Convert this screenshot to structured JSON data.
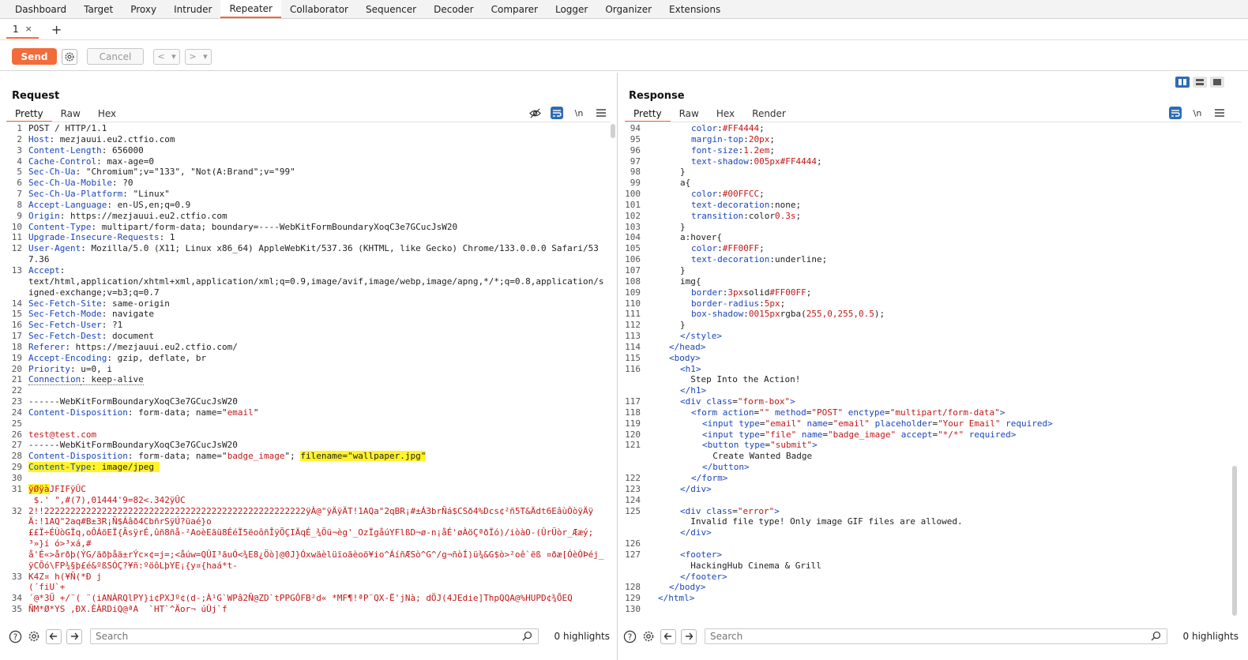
{
  "nav": {
    "tabs": [
      "Dashboard",
      "Target",
      "Proxy",
      "Intruder",
      "Repeater",
      "Collaborator",
      "Sequencer",
      "Decoder",
      "Comparer",
      "Logger",
      "Organizer",
      "Extensions"
    ],
    "active": "Repeater"
  },
  "subtabs": {
    "tab1_label": "1",
    "close": "×",
    "add": "+"
  },
  "toolbar": {
    "send": "Send",
    "cancel": "Cancel",
    "prev": "<",
    "next": ">",
    "drop": "▾"
  },
  "request": {
    "title": "Request",
    "tabs": [
      "Pretty",
      "Raw",
      "Hex"
    ],
    "icons": [
      "eye-off-icon",
      "wrap-icon",
      "newline-icon",
      "menu-icon"
    ],
    "lines": [
      {
        "n": "1",
        "parts": [
          [
            "",
            "POST / HTTP/1.1"
          ]
        ]
      },
      {
        "n": "2",
        "parts": [
          [
            "hk",
            "Host"
          ],
          [
            "",
            ": mezjauui.eu2.ctfio.com"
          ]
        ]
      },
      {
        "n": "3",
        "parts": [
          [
            "hk",
            "Content-Length"
          ],
          [
            "",
            ": 656000"
          ]
        ]
      },
      {
        "n": "4",
        "parts": [
          [
            "hk",
            "Cache-Control"
          ],
          [
            "",
            ": max-age=0"
          ]
        ]
      },
      {
        "n": "5",
        "parts": [
          [
            "hk",
            "Sec-Ch-Ua"
          ],
          [
            "",
            ": \"Chromium\";v=\"133\", \"Not(A:Brand\";v=\"99\""
          ]
        ]
      },
      {
        "n": "6",
        "parts": [
          [
            "hk",
            "Sec-Ch-Ua-Mobile"
          ],
          [
            "",
            ": ?0"
          ]
        ]
      },
      {
        "n": "7",
        "parts": [
          [
            "hk",
            "Sec-Ch-Ua-Platform"
          ],
          [
            "",
            ": \"Linux\""
          ]
        ]
      },
      {
        "n": "8",
        "parts": [
          [
            "hk",
            "Accept-Language"
          ],
          [
            "",
            ": en-US,en;q=0.9"
          ]
        ]
      },
      {
        "n": "9",
        "parts": [
          [
            "hk",
            "Origin"
          ],
          [
            "",
            ": https://mezjauui.eu2.ctfio.com"
          ]
        ]
      },
      {
        "n": "10",
        "parts": [
          [
            "hk",
            "Content-Type"
          ],
          [
            "",
            ": multipart/form-data; boundary=----WebKitFormBoundaryXoqC3e7GCucJsW20"
          ]
        ]
      },
      {
        "n": "11",
        "parts": [
          [
            "hk",
            "Upgrade-Insecure-Requests"
          ],
          [
            "",
            ": 1"
          ]
        ]
      },
      {
        "n": "12",
        "parts": [
          [
            "hk",
            "User-Agent"
          ],
          [
            "",
            ": Mozilla/5.0 (X11; Linux x86_64) AppleWebKit/537.36 (KHTML, like Gecko) Chrome/133.0.0.0 Safari/537.36"
          ]
        ]
      },
      {
        "n": "13",
        "parts": [
          [
            "hk",
            "Accept"
          ],
          [
            "",
            ":\ntext/html,application/xhtml+xml,application/xml;q=0.9,image/avif,image/webp,image/apng,*/*;q=0.8,application/signed-exchange;v=b3;q=0.7"
          ]
        ]
      },
      {
        "n": "14",
        "parts": [
          [
            "hk",
            "Sec-Fetch-Site"
          ],
          [
            "",
            ": same-origin"
          ]
        ]
      },
      {
        "n": "15",
        "parts": [
          [
            "hk",
            "Sec-Fetch-Mode"
          ],
          [
            "",
            ": navigate"
          ]
        ]
      },
      {
        "n": "16",
        "parts": [
          [
            "hk",
            "Sec-Fetch-User"
          ],
          [
            "",
            ": ?1"
          ]
        ]
      },
      {
        "n": "17",
        "parts": [
          [
            "hk",
            "Sec-Fetch-Dest"
          ],
          [
            "",
            ": document"
          ]
        ]
      },
      {
        "n": "18",
        "parts": [
          [
            "hk",
            "Referer"
          ],
          [
            "",
            ": https://mezjauui.eu2.ctfio.com/"
          ]
        ]
      },
      {
        "n": "19",
        "parts": [
          [
            "hk",
            "Accept-Encoding"
          ],
          [
            "",
            ": gzip, deflate, br"
          ]
        ]
      },
      {
        "n": "20",
        "parts": [
          [
            "hk",
            "Priority"
          ],
          [
            "",
            ": u=0, i"
          ]
        ]
      },
      {
        "n": "21",
        "parts": [
          [
            "hk dots",
            "Connection"
          ],
          [
            "dots",
            ": keep-alive"
          ]
        ]
      },
      {
        "n": "22",
        "parts": [
          [
            "",
            ""
          ]
        ]
      },
      {
        "n": "23",
        "parts": [
          [
            "",
            "------WebKitFormBoundaryXoqC3e7GCucJsW20"
          ]
        ]
      },
      {
        "n": "24",
        "parts": [
          [
            "hk",
            "Content-Disposition"
          ],
          [
            "",
            ": form-data; name=\""
          ],
          [
            "red",
            "email"
          ],
          [
            "",
            "\""
          ]
        ]
      },
      {
        "n": "25",
        "parts": [
          [
            "",
            ""
          ]
        ]
      },
      {
        "n": "26",
        "parts": [
          [
            "red",
            "test@test.com"
          ]
        ]
      },
      {
        "n": "27",
        "parts": [
          [
            "",
            "------WebKitFormBoundaryXoqC3e7GCucJsW20"
          ]
        ]
      },
      {
        "n": "28",
        "parts": [
          [
            "hk",
            "Content-Disposition"
          ],
          [
            "",
            ": form-data; name=\""
          ],
          [
            "red",
            "badge_image"
          ],
          [
            "",
            "\"; "
          ],
          [
            "hl",
            "filename=\"wallpaper.jpg\""
          ]
        ]
      },
      {
        "n": "29",
        "parts": [
          [
            "hl hk",
            "Content-Type"
          ],
          [
            "hl",
            ": image/jpeg "
          ]
        ]
      },
      {
        "n": "30",
        "parts": [
          [
            "",
            ""
          ]
        ]
      },
      {
        "n": "31",
        "parts": [
          [
            "red hl",
            "ÿØÿà"
          ],
          [
            "red",
            "JFIFÿÛC\n $.' \",#(7),01444'9=82<.342ÿÛC"
          ]
        ]
      },
      {
        "n": "32",
        "parts": [
          [
            "red",
            "2!!22222222222222222222222222222222222222222222222222ÿÀ@\"ÿÄÿÄT!1AQa\"2qBR¡#±Á3brÑá$CSð4%Dcs¢²ñ5T&Ädt6EâùÒòÿÄÿÄ:!1AQ\"2aq#B±3R¡Ñ$Áâð4CbñrSÿÚ?üaé}o\n££Ï÷ÉÙòGÏq,oÔÁöEÏ{ÃsÿrÉ,ûñ8ñå-²AoèEãü8ÉéÏ5ëoôñÎÿÕÇIÄqÉ_¾Öü¬èg'_OzÏgåúYFlßD¬ø-n¡åÉ'øÀöÇªðÏó)/iòàO-(ÛrÜòr_Ææý;³»}í ó>³xá,#\nå'É«>årðþ(ÝG/äðþåä±rÝc×¢=j=;<åúw=QÛI³ãuÓ<¾E8¿Öò]@0J}Óxwäèlüïoãèoö¥io^ÁíñÆSò^G^/g¬ñòÍ)ü¾&G$ò>²oê`ëß ¤ðæ[ÓèÒÞéj_ÿCÕó\\FP¾§þ£é&ºßSÓÇ?¥ñ:ºöôLþYE¡{y¤{haá*t-"
          ]
        ]
      },
      {
        "n": "33",
        "parts": [
          [
            "red",
            "K4Z¤ h(¥Ñ(*Ð j\n(´fiU`+"
          ]
        ]
      },
      {
        "n": "34",
        "parts": [
          [
            "red",
            "´@*3Ü +/¨( ¨(iANÀRQlPY}i¢PXJº¢(d-;À¹G`WPâ2Ñ@ZD`tPPGÔFB²d« *MF¶!ªP¨QX-Ë'jNà; dÖJ(4JEdie]ThpQQA@%HUPD¢¾ÕEQ"
          ]
        ]
      },
      {
        "n": "35",
        "parts": [
          [
            "red",
            "ÑM*Ø*YS ,ÐX.ÈÀRDiQ@ªA  `HT`^Äor¬ úÙj`f"
          ]
        ]
      }
    ]
  },
  "response": {
    "title": "Response",
    "tabs": [
      "Pretty",
      "Raw",
      "Hex",
      "Render"
    ],
    "icons": [
      "wrap-icon",
      "newline-icon",
      "menu-icon"
    ],
    "lines": [
      {
        "n": "94",
        "ind": 4,
        "parts": [
          [
            "cssp",
            "color"
          ],
          [
            "",
            ":"
          ],
          [
            "cssv",
            "#FF4444"
          ],
          [
            "",
            ";"
          ]
        ]
      },
      {
        "n": "95",
        "ind": 4,
        "parts": [
          [
            "cssp",
            "margin-top"
          ],
          [
            "",
            ":"
          ],
          [
            "cssv",
            "20px"
          ],
          [
            "",
            ";"
          ]
        ]
      },
      {
        "n": "96",
        "ind": 4,
        "parts": [
          [
            "cssp",
            "font-size"
          ],
          [
            "",
            ":"
          ],
          [
            "cssv",
            "1.2em"
          ],
          [
            "",
            ";"
          ]
        ]
      },
      {
        "n": "97",
        "ind": 4,
        "parts": [
          [
            "cssp",
            "text-shadow"
          ],
          [
            "",
            ":"
          ],
          [
            "cssv",
            "005px#FF4444"
          ],
          [
            "",
            ";"
          ]
        ]
      },
      {
        "n": "98",
        "ind": 3,
        "parts": [
          [
            "",
            "}"
          ]
        ]
      },
      {
        "n": "99",
        "ind": 3,
        "parts": [
          [
            "",
            "a{"
          ]
        ]
      },
      {
        "n": "100",
        "ind": 4,
        "parts": [
          [
            "cssp",
            "color"
          ],
          [
            "",
            ":"
          ],
          [
            "cssv",
            "#00FFCC"
          ],
          [
            "",
            ";"
          ]
        ]
      },
      {
        "n": "101",
        "ind": 4,
        "parts": [
          [
            "cssp",
            "text-decoration"
          ],
          [
            "",
            ":none;"
          ]
        ]
      },
      {
        "n": "102",
        "ind": 4,
        "parts": [
          [
            "cssp",
            "transition"
          ],
          [
            "",
            ":color"
          ],
          [
            "cssv",
            "0.3s"
          ],
          [
            "",
            ";"
          ]
        ]
      },
      {
        "n": "103",
        "ind": 3,
        "parts": [
          [
            "",
            "}"
          ]
        ]
      },
      {
        "n": "104",
        "ind": 3,
        "parts": [
          [
            "",
            "a:hover{"
          ]
        ]
      },
      {
        "n": "105",
        "ind": 4,
        "parts": [
          [
            "cssp",
            "color"
          ],
          [
            "",
            ":"
          ],
          [
            "cssv",
            "#FF00FF"
          ],
          [
            "",
            ";"
          ]
        ]
      },
      {
        "n": "106",
        "ind": 4,
        "parts": [
          [
            "cssp",
            "text-decoration"
          ],
          [
            "",
            ":underline;"
          ]
        ]
      },
      {
        "n": "107",
        "ind": 3,
        "parts": [
          [
            "",
            "}"
          ]
        ]
      },
      {
        "n": "108",
        "ind": 3,
        "parts": [
          [
            "",
            "img{"
          ]
        ]
      },
      {
        "n": "109",
        "ind": 4,
        "parts": [
          [
            "cssp",
            "border"
          ],
          [
            "",
            ":"
          ],
          [
            "cssv",
            "3px"
          ],
          [
            "",
            "solid"
          ],
          [
            "cssv",
            "#FF00FF"
          ],
          [
            "",
            ";"
          ]
        ]
      },
      {
        "n": "110",
        "ind": 4,
        "parts": [
          [
            "cssp",
            "border-radius"
          ],
          [
            "",
            ":"
          ],
          [
            "cssv",
            "5px"
          ],
          [
            "",
            ";"
          ]
        ]
      },
      {
        "n": "111",
        "ind": 4,
        "parts": [
          [
            "cssp",
            "box-shadow"
          ],
          [
            "",
            ":"
          ],
          [
            "cssv",
            "0015px"
          ],
          [
            "",
            "rgba("
          ],
          [
            "cssv",
            "255,0,255,0.5"
          ],
          [
            "",
            ");"
          ]
        ]
      },
      {
        "n": "112",
        "ind": 3,
        "parts": [
          [
            "",
            "}"
          ]
        ]
      },
      {
        "n": "113",
        "ind": 3,
        "parts": [
          [
            "tag",
            "</style>"
          ]
        ]
      },
      {
        "n": "114",
        "ind": 2,
        "parts": [
          [
            "tag",
            "</head>"
          ]
        ]
      },
      {
        "n": "115",
        "ind": 2,
        "parts": [
          [
            "tag",
            "<body>"
          ]
        ]
      },
      {
        "n": "116",
        "ind": 3,
        "parts": [
          [
            "tag",
            "<h1>"
          ],
          [
            "",
            "\n  Step Into the Action!\n"
          ],
          [
            "tag",
            "</h1>"
          ]
        ]
      },
      {
        "n": "117",
        "ind": 3,
        "parts": [
          [
            "tag",
            "<div "
          ],
          [
            "attr",
            "class"
          ],
          [
            "",
            "="
          ],
          [
            "val",
            "\"form-box\""
          ],
          [
            "tag",
            ">"
          ]
        ]
      },
      {
        "n": "118",
        "ind": 4,
        "parts": [
          [
            "tag",
            "<form "
          ],
          [
            "attr",
            "action"
          ],
          [
            "",
            "="
          ],
          [
            "val",
            "\"\""
          ],
          [
            "attr",
            " method"
          ],
          [
            "",
            "="
          ],
          [
            "val",
            "\"POST\""
          ],
          [
            "attr",
            " enctype"
          ],
          [
            "",
            "="
          ],
          [
            "val",
            "\"multipart/form-data\""
          ],
          [
            "tag",
            ">"
          ]
        ]
      },
      {
        "n": "119",
        "ind": 5,
        "parts": [
          [
            "tag",
            "<input "
          ],
          [
            "attr",
            "type"
          ],
          [
            "",
            "="
          ],
          [
            "val",
            "\"email\""
          ],
          [
            "attr",
            " name"
          ],
          [
            "",
            "="
          ],
          [
            "val",
            "\"email\""
          ],
          [
            "attr",
            " placeholder"
          ],
          [
            "",
            "="
          ],
          [
            "val",
            "\"Your Email\""
          ],
          [
            "attr",
            " required"
          ],
          [
            "tag",
            ">"
          ]
        ]
      },
      {
        "n": "120",
        "ind": 5,
        "parts": [
          [
            "tag",
            "<input "
          ],
          [
            "attr",
            "type"
          ],
          [
            "",
            "="
          ],
          [
            "val",
            "\"file\""
          ],
          [
            "attr",
            " name"
          ],
          [
            "",
            "="
          ],
          [
            "val",
            "\"badge_image\""
          ],
          [
            "attr",
            " accept"
          ],
          [
            "",
            "="
          ],
          [
            "val",
            "\"*/*\""
          ],
          [
            "attr",
            " required"
          ],
          [
            "tag",
            ">"
          ]
        ]
      },
      {
        "n": "121",
        "ind": 5,
        "parts": [
          [
            "tag",
            "<button "
          ],
          [
            "attr",
            "type"
          ],
          [
            "",
            "="
          ],
          [
            "val",
            "\"submit\""
          ],
          [
            "tag",
            ">"
          ],
          [
            "",
            "\n  Create Wanted Badge\n"
          ],
          [
            "tag",
            "</button>"
          ]
        ]
      },
      {
        "n": "122",
        "ind": 4,
        "parts": [
          [
            "tag",
            "</form>"
          ]
        ]
      },
      {
        "n": "123",
        "ind": 3,
        "parts": [
          [
            "tag",
            "</div>"
          ]
        ]
      },
      {
        "n": "124",
        "ind": 0,
        "parts": [
          [
            "",
            ""
          ]
        ]
      },
      {
        "n": "125",
        "ind": 3,
        "parts": [
          [
            "tag",
            "<div "
          ],
          [
            "attr",
            "class"
          ],
          [
            "",
            "="
          ],
          [
            "val",
            "\"error\""
          ],
          [
            "tag",
            ">"
          ],
          [
            "",
            "\n  Invalid file type! Only image GIF files are allowed.\n"
          ],
          [
            "tag",
            "</div>"
          ]
        ]
      },
      {
        "n": "126",
        "ind": 0,
        "parts": [
          [
            "",
            ""
          ]
        ]
      },
      {
        "n": "127",
        "ind": 3,
        "parts": [
          [
            "tag",
            "<footer>"
          ],
          [
            "",
            "\n  HackingHub Cinema & Grill\n"
          ],
          [
            "tag",
            "</footer>"
          ]
        ]
      },
      {
        "n": "128",
        "ind": 2,
        "parts": [
          [
            "tag",
            "</body>"
          ]
        ]
      },
      {
        "n": "129",
        "ind": 1,
        "parts": [
          [
            "tag",
            "</html>"
          ]
        ]
      },
      {
        "n": "130",
        "ind": 0,
        "parts": [
          [
            "",
            ""
          ]
        ]
      }
    ]
  },
  "footer": {
    "search_placeholder": "Search",
    "highlights": "0 highlights"
  }
}
